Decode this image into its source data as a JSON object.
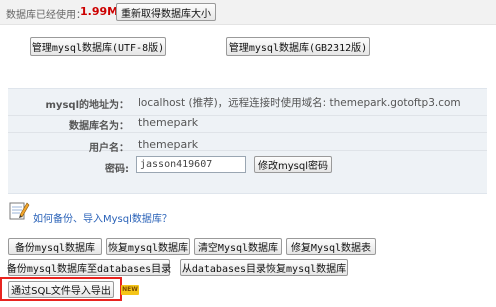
{
  "top": {
    "usage_label": "数据库已经使用：",
    "usage_value": "1.99MB",
    "refresh_button": "重新取得数据库大小"
  },
  "manage": {
    "utf8_button": "管理mysql数据库(UTF-8版)",
    "gb2312_button": "管理mysql数据库(GB2312版)"
  },
  "info": {
    "address_label": "mysql的地址为：",
    "address_value": "localhost (推荐)，远程连接时使用域名: themepark.gotoftp3.com",
    "dbname_label": "数据库名为：",
    "dbname_value": "themepark",
    "username_label": "用户名：",
    "username_value": "themepark",
    "password_label": "密码:",
    "password_value": "jasson419607",
    "change_password_button": "修改mysql密码"
  },
  "help": {
    "link": "如何备份、导入Mysql数据库？"
  },
  "actions": {
    "backup": "备份mysql数据库",
    "restore": "恢复mysql数据库",
    "clear": "清空Mysql数据库",
    "repair": "修复Mysql数据表",
    "backup_to_dir": "备份mysql数据库至databases目录",
    "restore_from_dir": "从databases目录恢复mysql数据库",
    "import_sql": "通过SQL文件导入导出",
    "new_badge": "NEW"
  },
  "colors": {
    "usage_value": "#cc0000",
    "link": "#2a62b8",
    "highlight": "#e8241f",
    "badge": "#f5c518"
  }
}
